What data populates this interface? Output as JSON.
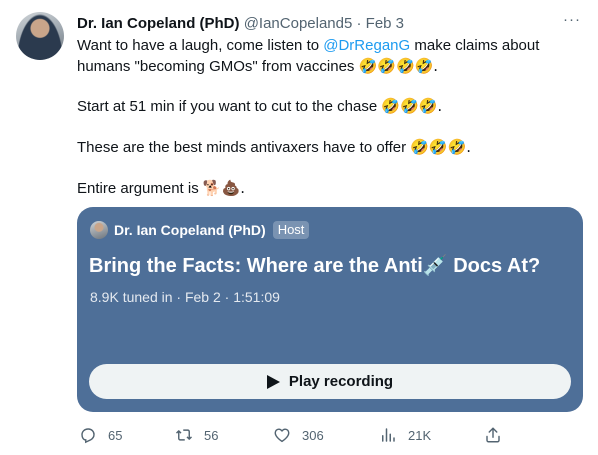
{
  "tweet": {
    "author_name": "Dr. Ian Copeland (PhD)",
    "handle": "@IanCopeland5",
    "separator": " · ",
    "date": "Feb 3",
    "more_label": "···",
    "line1_prefix": "Want to have a laugh, come listen to ",
    "mention": "@DrReganG",
    "line1_suffix": " make claims about humans \"becoming GMOs\" from vaccines ",
    "line1_emoji": "🤣🤣🤣🤣.",
    "line2": "Start at 51 min if you want to cut to the chase ",
    "line2_emoji": "🤣🤣🤣.",
    "line3": "These are the best minds antivaxers have to offer ",
    "line3_emoji": "🤣🤣🤣.",
    "line4": "Entire argument is ",
    "line4_emoji": "🐕💩."
  },
  "space_card": {
    "host_name": "Dr. Ian Copeland (PhD)",
    "host_badge": "Host",
    "title": "Bring the Facts: Where are the Anti💉 Docs At?",
    "stats": "8.9K tuned in · Feb 2 · 1:51:09",
    "play_label": "Play recording",
    "background_color": "#4e6f98"
  },
  "actions": {
    "replies": "65",
    "retweets": "56",
    "likes": "306",
    "views": "21K"
  }
}
